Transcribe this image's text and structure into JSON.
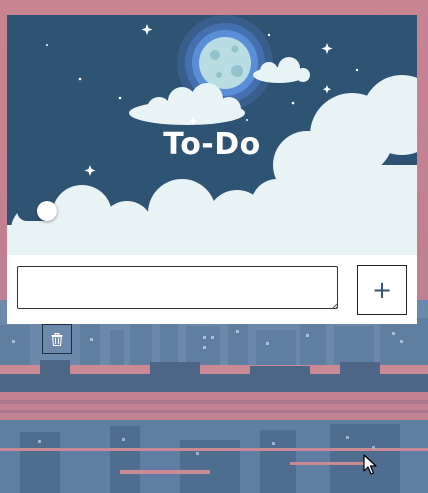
{
  "app": {
    "title": "To-Do"
  },
  "todo_input": {
    "value": "",
    "placeholder": ""
  },
  "add_button": {
    "label": "+"
  },
  "theme_toggle": {
    "state": "on"
  },
  "colors": {
    "sky": "#2f5372",
    "cloud": "#e8f3f6",
    "moon": "#b8dce4",
    "moon_glow": "#4a7fd0",
    "background_pink": "#c9838f",
    "background_blue": "#5e7fa2"
  },
  "icons": {
    "add": "plus-icon",
    "delete": "trash-icon",
    "moon": "moon-icon"
  }
}
